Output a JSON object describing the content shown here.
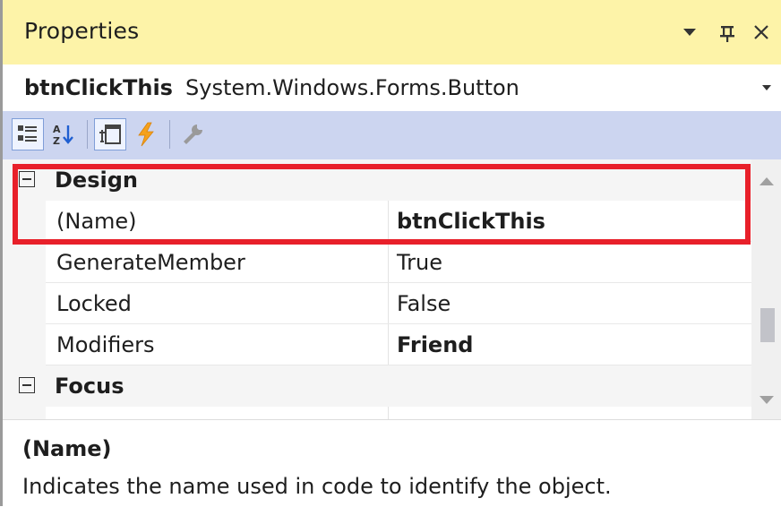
{
  "window": {
    "title": "Properties",
    "dropdown_glyph": "▾",
    "pin_glyph": "⊥",
    "close_glyph": "✕"
  },
  "object_selector": {
    "name": "btnClickThis",
    "type": "System.Windows.Forms.Button"
  },
  "toolbar": {
    "buttons": [
      {
        "icon": "categorized-icon",
        "active": true
      },
      {
        "icon": "alphabetical-icon",
        "active": false
      },
      {
        "icon": "properties-icon",
        "active": true
      },
      {
        "icon": "events-icon",
        "active": false
      },
      {
        "icon": "property-pages-icon",
        "active": false
      }
    ]
  },
  "grid": {
    "categories": [
      {
        "label": "Design",
        "expanded": true
      },
      {
        "label": "Focus",
        "expanded": true
      }
    ],
    "properties": [
      {
        "name": "(Name)",
        "value": "btnClickThis",
        "bold": true
      },
      {
        "name": "GenerateMember",
        "value": "True",
        "bold": false
      },
      {
        "name": "Locked",
        "value": "False",
        "bold": false
      },
      {
        "name": "Modifiers",
        "value": "Friend",
        "bold": true
      }
    ]
  },
  "description": {
    "title": "(Name)",
    "text": "Indicates the name used in code to identify the object."
  },
  "colors": {
    "title_bar": "#fdf3a8",
    "toolbar": "#ccd5f0",
    "highlight": "#e8202a"
  }
}
